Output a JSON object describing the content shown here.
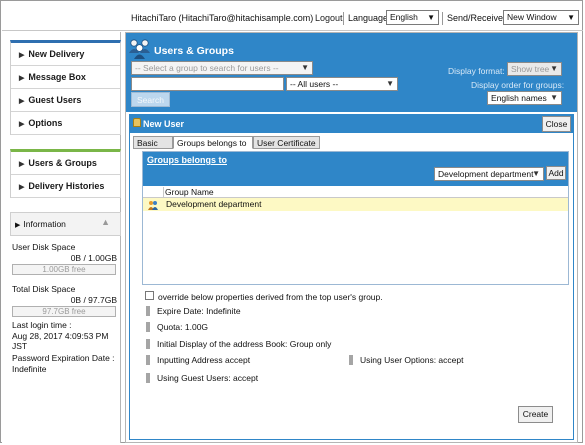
{
  "topbar": {
    "user": "HitachiTaro (HitachiTaro@hitachisample.com)",
    "logout": "Logout",
    "language_label": "Language",
    "language_value": "English",
    "send_receive_label": "Send/Receive",
    "send_receive_value": "New Window"
  },
  "nav": {
    "group1": [
      "New Delivery",
      "Message Box",
      "Guest Users",
      "Options"
    ],
    "group2": [
      "Users & Groups",
      "Delivery Histories"
    ]
  },
  "info": {
    "title": "Information",
    "user_disk_label": "User Disk Space",
    "user_disk_value": "0B / 1.00GB",
    "user_disk_free": "1.00GB free",
    "total_disk_label": "Total Disk Space",
    "total_disk_value": "0B / 97.7GB",
    "total_disk_free": "97.7GB free",
    "last_login_label": "Last login time :",
    "last_login_date": "Aug 28, 2017 4:09:53 PM",
    "last_login_tz": "JST",
    "password_label": "Password Expiration Date :",
    "password_value": "Indefinite"
  },
  "main": {
    "title": "Users & Groups",
    "group_search_placeholder": "-- Select a group to search for users --",
    "users_select": "-- All users --",
    "search_button": "Search",
    "display_format_label": "Display format:",
    "display_format_value": "Show tree",
    "display_order_label": "Display order for groups:",
    "display_order_value": "English names"
  },
  "dialog": {
    "title": "New User",
    "close": "Close",
    "tabs": [
      "Basic",
      "Groups belongs to",
      "User Certificate"
    ],
    "inner_title": "Groups belongs to",
    "group_select": "Development department",
    "add": "Add",
    "column_group_name": "Group Name",
    "rows": [
      "Development department"
    ],
    "override_label": "override below properties derived from the top user's group.",
    "expire": "Expire Date: Indefinite",
    "quota": "Quota: 1.00G",
    "initial_display": "Initial Display of the address Book: Group only",
    "inputting_address": "Inputting Address accept",
    "using_user_options": "Using User Options: accept",
    "using_guest_users": "Using Guest Users: accept",
    "create": "Create"
  },
  "colors": {
    "header_blue": "#2f86c8",
    "nav_blue": "#2f6fb0",
    "nav_green": "#7ab648",
    "highlight_row": "#fdf9c4"
  }
}
